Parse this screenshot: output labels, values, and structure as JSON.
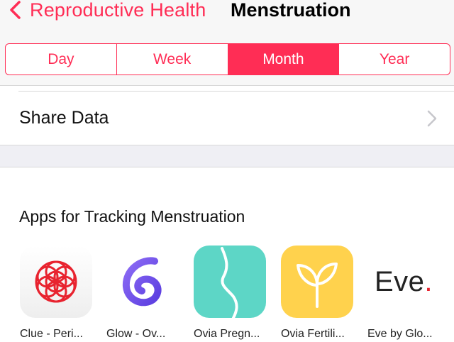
{
  "nav": {
    "back_label": "Reproductive Health",
    "title": "Menstruation"
  },
  "segments": [
    {
      "label": "Day",
      "active": false
    },
    {
      "label": "Week",
      "active": false
    },
    {
      "label": "Month",
      "active": true
    },
    {
      "label": "Year",
      "active": false
    }
  ],
  "share": {
    "label": "Share Data"
  },
  "apps_section": {
    "title": "Apps for Tracking Menstruation",
    "apps": [
      {
        "name": "Clue - Peri...",
        "icon": "clue-flower-icon"
      },
      {
        "name": "Glow - Ov...",
        "icon": "glow-g-icon"
      },
      {
        "name": "Ovia Pregn...",
        "icon": "ovia-pregnancy-icon"
      },
      {
        "name": "Ovia Fertili...",
        "icon": "ovia-fertility-sprout-icon"
      },
      {
        "name": "Eve by Glo...",
        "icon": "eve-wordmark-icon",
        "icon_text": "Eve."
      }
    ]
  },
  "colors": {
    "accent": "#ff2d55",
    "background": "#ffffff",
    "nav_background": "#f7f7f7",
    "section_band": "#efeff4"
  }
}
